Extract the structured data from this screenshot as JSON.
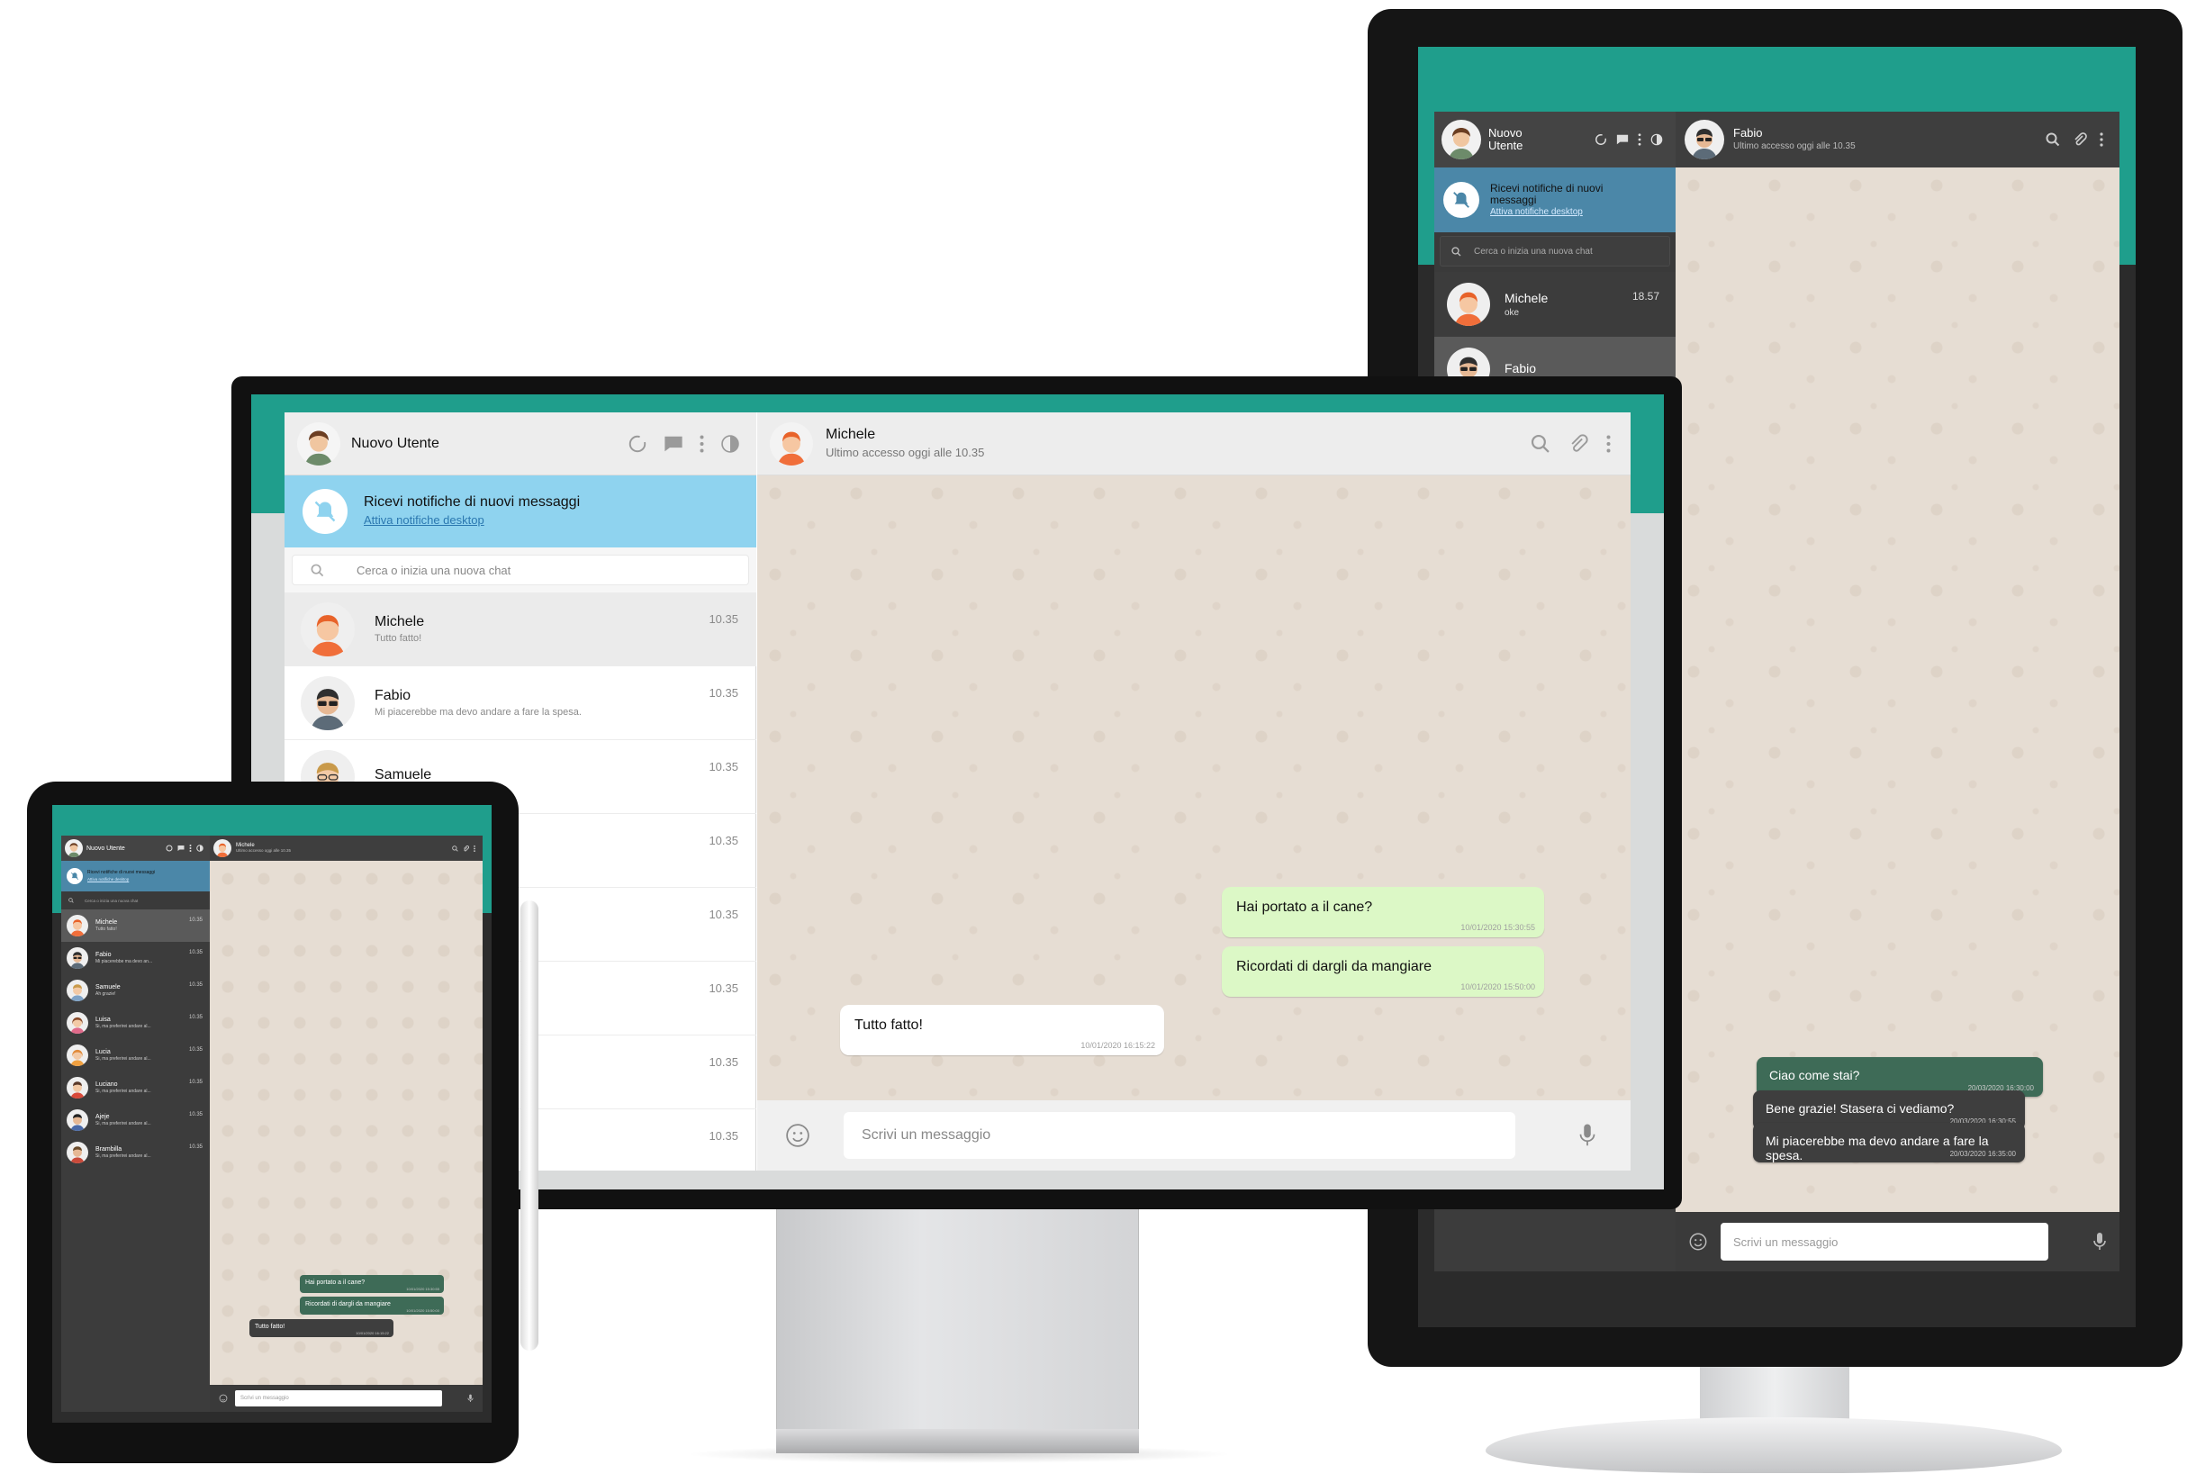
{
  "colors": {
    "teal": "#1f9e8c",
    "notify_light": "#8fd3ef",
    "notify_dark": "#4b87a8",
    "bubble_sent_light": "#dcf8c6",
    "bubble_dark": "#3e6b57"
  },
  "main": {
    "user_name": "Nuovo Utente",
    "notify_title": "Ricevi notifiche di nuovi messaggi",
    "notify_link": "Attiva notifiche desktop",
    "search_placeholder": "Cerca o inizia una nuova chat",
    "contacts": [
      {
        "name": "Michele",
        "preview": "Tutto fatto!",
        "time": "10.35"
      },
      {
        "name": "Fabio",
        "preview": "Mi piacerebbe ma devo andare a fare la spesa.",
        "time": "10.35"
      },
      {
        "name": "Samuele",
        "preview": "",
        "time": "10.35"
      },
      {
        "name": "",
        "preview": "",
        "time": "10.35"
      },
      {
        "name": "",
        "preview": "",
        "time": "10.35"
      },
      {
        "name": "",
        "preview": "",
        "time": "10.35"
      },
      {
        "name": "",
        "preview": "",
        "time": "10.35"
      },
      {
        "name": "",
        "preview": "",
        "time": "10.35"
      }
    ],
    "chat_name": "Michele",
    "chat_status": "Ultimo accesso oggi alle 10.35",
    "messages": [
      {
        "text": "Hai portato a il cane?",
        "ts": "10/01/2020 15:30:55",
        "type": "sent"
      },
      {
        "text": "Ricordati di dargli da mangiare",
        "ts": "10/01/2020 15:50:00",
        "type": "sent"
      },
      {
        "text": "Tutto fatto!",
        "ts": "10/01/2020 16:15:22",
        "type": "received"
      }
    ],
    "composer_placeholder": "Scrivi un messaggio"
  },
  "right": {
    "user_name_1": "Nuovo",
    "user_name_2": "Utente",
    "notify_title_1": "Ricevi notifiche di nuovi",
    "notify_title_2": "messaggi",
    "notify_link": "Attiva notifiche desktop",
    "search_placeholder": "Cerca o inizia una nuova chat",
    "contacts": [
      {
        "name": "Michele",
        "preview": "oke",
        "time": "18.57"
      },
      {
        "name": "Fabio",
        "preview": "",
        "time": ""
      }
    ],
    "chat_name": "Fabio",
    "chat_status": "Ultimo accesso oggi alle 10.35",
    "messages": [
      {
        "text": "Ciao come stai?",
        "ts": "20/03/2020 16:30:00",
        "type": "sent"
      },
      {
        "text": "Bene grazie! Stasera ci vediamo?",
        "ts": "20/03/2020 16:30:55",
        "type": "received"
      },
      {
        "text": "Mi piacerebbe ma devo andare a fare la spesa.",
        "ts": "20/03/2020 16:35:00",
        "type": "received"
      }
    ],
    "composer_placeholder": "Scrivi un messaggio"
  },
  "tablet": {
    "user_name": "Nuovo Utente",
    "notify_title": "Ricevi notifiche di nuovi messaggi",
    "notify_link": "Attiva notifiche desktop",
    "search_placeholder": "Cerca o inizia una nuova chat",
    "chat_name": "Michele",
    "chat_status": "Ultimo accesso oggi alle 10.35",
    "contacts": [
      {
        "name": "Michele",
        "preview": "Tutto fatto!",
        "time": "10.35"
      },
      {
        "name": "Fabio",
        "preview": "Mi piacerebbe ma devo an...",
        "time": "10.35"
      },
      {
        "name": "Samuele",
        "preview": "Ah grazie!",
        "time": "10.35"
      },
      {
        "name": "Luisa",
        "preview": "Si, ma preferirei andare al...",
        "time": "10.35"
      },
      {
        "name": "Lucia",
        "preview": "Si, ma preferirei andare al...",
        "time": "10.35"
      },
      {
        "name": "Luciano",
        "preview": "Si, ma preferirei andare al...",
        "time": "10.35"
      },
      {
        "name": "Ajeje",
        "preview": "Si, ma preferirei andare al...",
        "time": "10.35"
      },
      {
        "name": "Brambilla",
        "preview": "Si, ma preferirei andare al...",
        "time": "10.35"
      }
    ],
    "messages": [
      {
        "text": "Hai portato a il cane?",
        "ts": "10/01/2020 15:30:55",
        "type": "sent"
      },
      {
        "text": "Ricordati di dargli da mangiare",
        "ts": "10/01/2020 15:50:00",
        "type": "sent"
      },
      {
        "text": "Tutto fatto!",
        "ts": "10/01/2020 16:15:22",
        "type": "received"
      }
    ],
    "composer_placeholder": "Scrivi un messaggio"
  },
  "icons": [
    "status-ring-icon",
    "chat-bubble-icon",
    "menu-dots-icon",
    "theme-toggle-icon",
    "bell-off-icon",
    "search-icon",
    "paperclip-icon",
    "emoji-icon",
    "microphone-icon"
  ]
}
